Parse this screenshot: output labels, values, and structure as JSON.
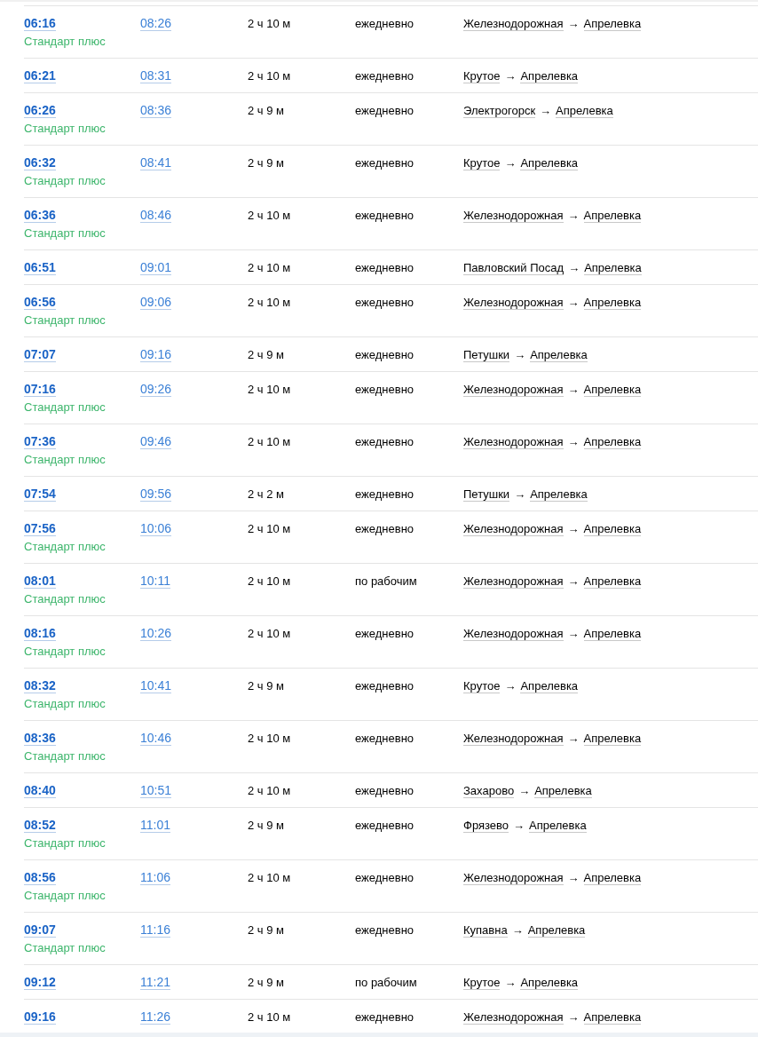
{
  "trains": [
    {
      "departure": "06:16",
      "arrival": "08:26",
      "duration": "2 ч 10 м",
      "days": "ежедневно",
      "from": "Железнодорожная",
      "arrow": "→",
      "to": "Апрелевка",
      "tariff": "Стандарт плюс"
    },
    {
      "departure": "06:21",
      "arrival": "08:31",
      "duration": "2 ч 10 м",
      "days": "ежедневно",
      "from": "Крутое",
      "arrow": "→",
      "to": "Апрелевка"
    },
    {
      "departure": "06:26",
      "arrival": "08:36",
      "duration": "2 ч 9 м",
      "days": "ежедневно",
      "from": "Электрогорск",
      "arrow": "→",
      "to": "Апрелевка",
      "tariff": "Стандарт плюс"
    },
    {
      "departure": "06:32",
      "arrival": "08:41",
      "duration": "2 ч 9 м",
      "days": "ежедневно",
      "from": "Крутое",
      "arrow": "→",
      "to": "Апрелевка",
      "tariff": "Стандарт плюс"
    },
    {
      "departure": "06:36",
      "arrival": "08:46",
      "duration": "2 ч 10 м",
      "days": "ежедневно",
      "from": "Железнодорожная",
      "arrow": "→",
      "to": "Апрелевка",
      "tariff": "Стандарт плюс"
    },
    {
      "departure": "06:51",
      "arrival": "09:01",
      "duration": "2 ч 10 м",
      "days": "ежедневно",
      "from": "Павловский Посад",
      "arrow": "→",
      "to": "Апрелевка"
    },
    {
      "departure": "06:56",
      "arrival": "09:06",
      "duration": "2 ч 10 м",
      "days": "ежедневно",
      "from": "Железнодорожная",
      "arrow": "→",
      "to": "Апрелевка",
      "tariff": "Стандарт плюс"
    },
    {
      "departure": "07:07",
      "arrival": "09:16",
      "duration": "2 ч 9 м",
      "days": "ежедневно",
      "from": "Петушки",
      "arrow": "→",
      "to": "Апрелевка"
    },
    {
      "departure": "07:16",
      "arrival": "09:26",
      "duration": "2 ч 10 м",
      "days": "ежедневно",
      "from": "Железнодорожная",
      "arrow": "→",
      "to": "Апрелевка",
      "tariff": "Стандарт плюс"
    },
    {
      "departure": "07:36",
      "arrival": "09:46",
      "duration": "2 ч 10 м",
      "days": "ежедневно",
      "from": "Железнодорожная",
      "arrow": "→",
      "to": "Апрелевка",
      "tariff": "Стандарт плюс"
    },
    {
      "departure": "07:54",
      "arrival": "09:56",
      "duration": "2 ч 2 м",
      "days": "ежедневно",
      "from": "Петушки",
      "arrow": "→",
      "to": "Апрелевка"
    },
    {
      "departure": "07:56",
      "arrival": "10:06",
      "duration": "2 ч 10 м",
      "days": "ежедневно",
      "from": "Железнодорожная",
      "arrow": "→",
      "to": "Апрелевка",
      "tariff": "Стандарт плюс"
    },
    {
      "departure": "08:01",
      "arrival": "10:11",
      "duration": "2 ч 10 м",
      "days": "по рабочим",
      "from": "Железнодорожная",
      "arrow": "→",
      "to": "Апрелевка",
      "tariff": "Стандарт плюс"
    },
    {
      "departure": "08:16",
      "arrival": "10:26",
      "duration": "2 ч 10 м",
      "days": "ежедневно",
      "from": "Железнодорожная",
      "arrow": "→",
      "to": "Апрелевка",
      "tariff": "Стандарт плюс"
    },
    {
      "departure": "08:32",
      "arrival": "10:41",
      "duration": "2 ч 9 м",
      "days": "ежедневно",
      "from": "Крутое",
      "arrow": "→",
      "to": "Апрелевка",
      "tariff": "Стандарт плюс"
    },
    {
      "departure": "08:36",
      "arrival": "10:46",
      "duration": "2 ч 10 м",
      "days": "ежедневно",
      "from": "Железнодорожная",
      "arrow": "→",
      "to": "Апрелевка",
      "tariff": "Стандарт плюс"
    },
    {
      "departure": "08:40",
      "arrival": "10:51",
      "duration": "2 ч 10 м",
      "days": "ежедневно",
      "from": "Захарово",
      "arrow": "→",
      "to": "Апрелевка"
    },
    {
      "departure": "08:52",
      "arrival": "11:01",
      "duration": "2 ч 9 м",
      "days": "ежедневно",
      "from": "Фрязево",
      "arrow": "→",
      "to": "Апрелевка",
      "tariff": "Стандарт плюс"
    },
    {
      "departure": "08:56",
      "arrival": "11:06",
      "duration": "2 ч 10 м",
      "days": "ежедневно",
      "from": "Железнодорожная",
      "arrow": "→",
      "to": "Апрелевка",
      "tariff": "Стандарт плюс"
    },
    {
      "departure": "09:07",
      "arrival": "11:16",
      "duration": "2 ч 9 м",
      "days": "ежедневно",
      "from": "Купавна",
      "arrow": "→",
      "to": "Апрелевка",
      "tariff": "Стандарт плюс"
    },
    {
      "departure": "09:12",
      "arrival": "11:21",
      "duration": "2 ч 9 м",
      "days": "по рабочим",
      "from": "Крутое",
      "arrow": "→",
      "to": "Апрелевка"
    },
    {
      "departure": "09:16",
      "arrival": "11:26",
      "duration": "2 ч 10 м",
      "days": "ежедневно",
      "from": "Железнодорожная",
      "arrow": "→",
      "to": "Апрелевка"
    }
  ]
}
